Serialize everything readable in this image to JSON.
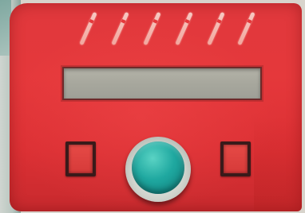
{
  "scene": {
    "description_free": true
  },
  "panel": {
    "body_color": "#e5383b",
    "decoration_count": 6
  },
  "display": {
    "screen_text": ""
  },
  "controls": {
    "left_button_icon": "square-button-icon",
    "right_button_icon": "square-button-icon",
    "knob_icon": "rotary-knob-icon",
    "knob_color": "#1fa8a0"
  },
  "colors": {
    "panel_red": "#e5383b",
    "lcd_gray": "#a7a79d",
    "knob_teal": "#1fa8a0",
    "stripe_pink": "#f2a79e"
  }
}
